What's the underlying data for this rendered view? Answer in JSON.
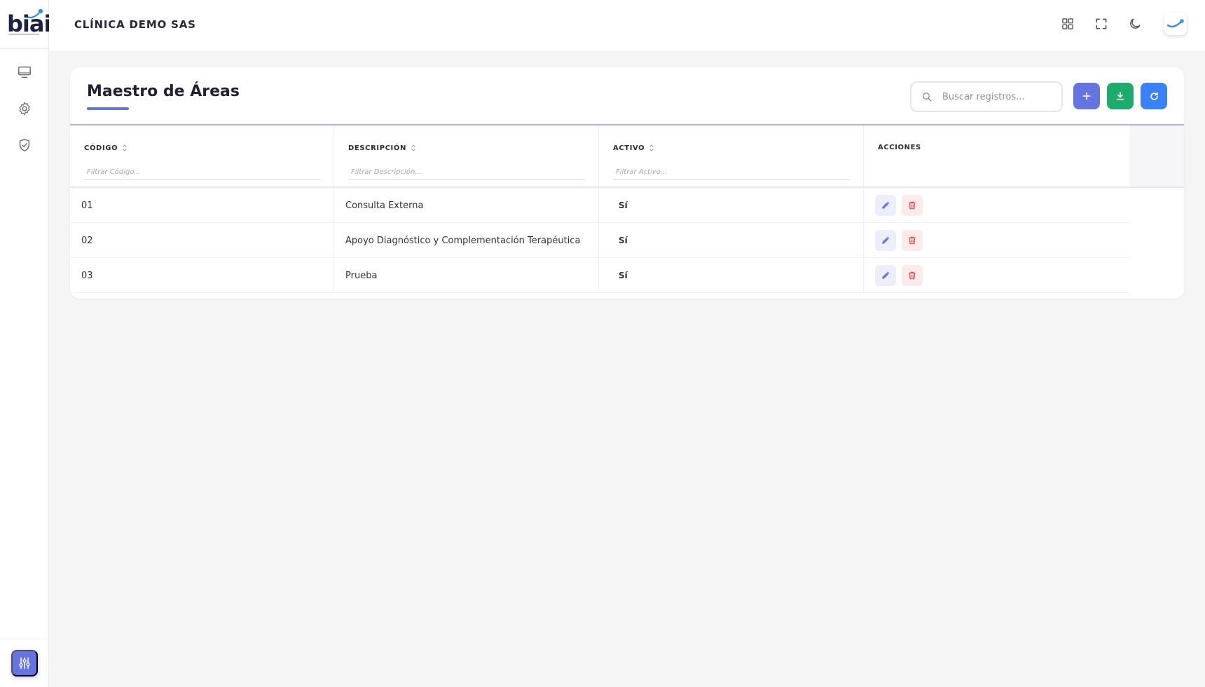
{
  "app": {
    "logo_text": "biai",
    "company_name": "CLÍNICA DEMO SAS"
  },
  "sidebar": {
    "items": [
      {
        "icon": "monitor-icon"
      },
      {
        "icon": "gear-icon"
      },
      {
        "icon": "shield-check-icon"
      }
    ],
    "bottom_button_icon": "sliders-icon"
  },
  "header": {
    "icons": [
      "apps-grid-icon",
      "fullscreen-icon",
      "moon-icon"
    ],
    "avatar_icon": "brand-swoosh-icon"
  },
  "page": {
    "title": "Maestro de Áreas",
    "search_placeholder": "Buscar registros...",
    "actions": [
      {
        "name": "add",
        "icon": "plus-icon",
        "color": "#6674e0"
      },
      {
        "name": "download",
        "icon": "download-icon",
        "color": "#1fab6e"
      },
      {
        "name": "refresh",
        "icon": "refresh-icon",
        "color": "#3b82f6"
      }
    ]
  },
  "table": {
    "columns": [
      {
        "label": "CÓDIGO",
        "filter_placeholder": "Filtrar Código..."
      },
      {
        "label": "DESCRIPCIÓN",
        "filter_placeholder": "Filtrar Descripción..."
      },
      {
        "label": "ACTIVO",
        "filter_placeholder": "Filtrar Activo..."
      },
      {
        "label": "ACCIONES"
      }
    ],
    "rows": [
      {
        "codigo": "01",
        "descripcion": "Consulta Externa",
        "activo": "Sí"
      },
      {
        "codigo": "02",
        "descripcion": "Apoyo Diagnóstico y Complementación Terapéutica",
        "activo": "Sí"
      },
      {
        "codigo": "03",
        "descripcion": "Prueba",
        "activo": "Sí"
      }
    ]
  },
  "colors": {
    "accent": "#6674e0",
    "success": "#1fab6e",
    "info": "#3b82f6",
    "danger": "#e54848"
  }
}
